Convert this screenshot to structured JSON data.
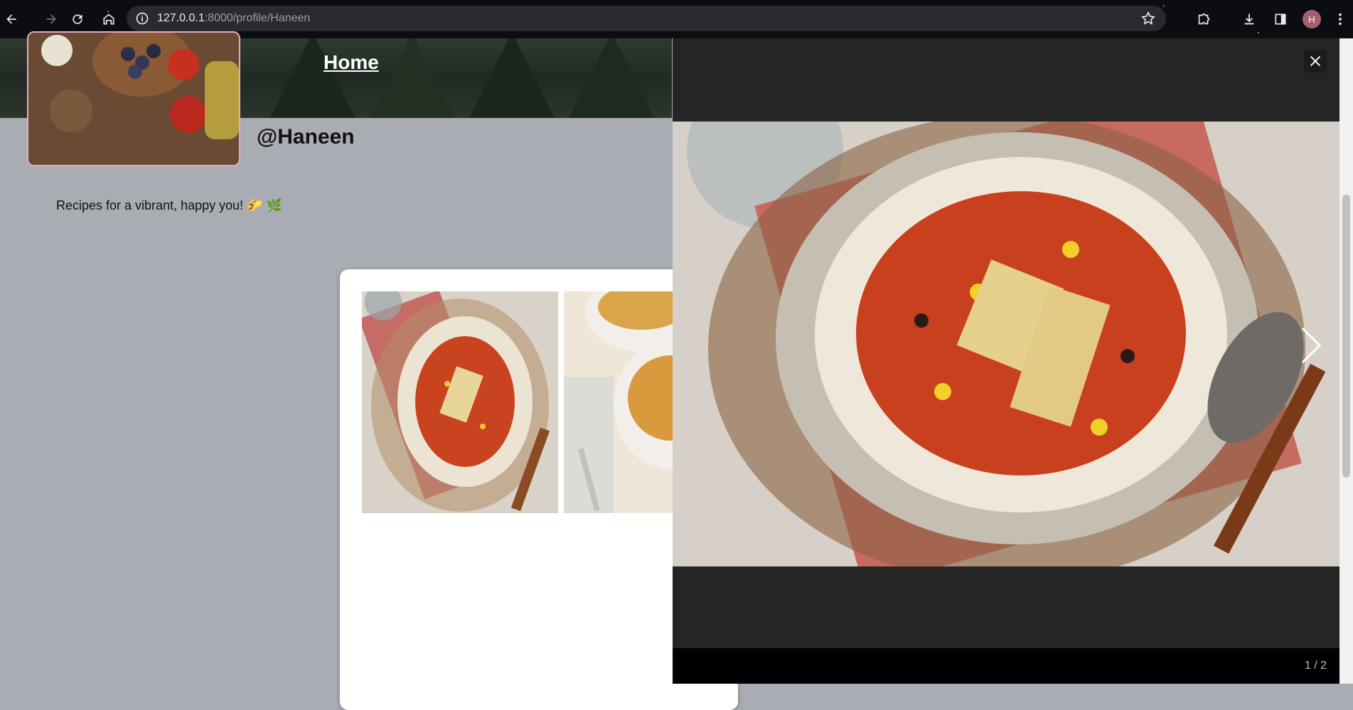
{
  "browser": {
    "url_host": "127.0.0.1",
    "url_rest": ":8000/profile/Haneen",
    "avatar_initial": "H"
  },
  "page": {
    "home_label": "Home",
    "username": "@Haneen",
    "bio": "Recipes for a vibrant, happy you! 🌮 🌿"
  },
  "lightbox": {
    "counter": "1 / 2",
    "close_icon": "close-icon",
    "next_icon": "chevron-right-icon"
  }
}
